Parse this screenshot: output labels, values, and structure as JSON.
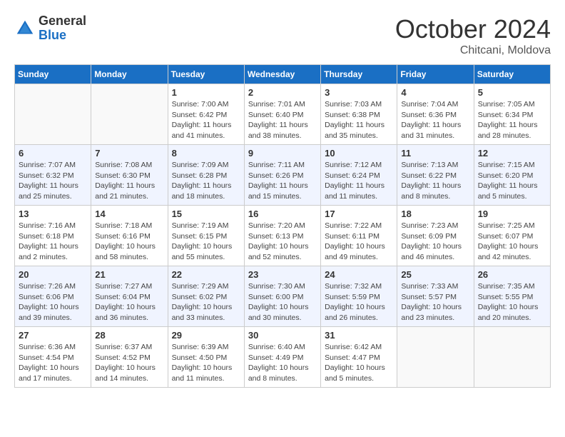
{
  "header": {
    "logo_general": "General",
    "logo_blue": "Blue",
    "month_title": "October 2024",
    "location": "Chitcani, Moldova"
  },
  "calendar": {
    "days_of_week": [
      "Sunday",
      "Monday",
      "Tuesday",
      "Wednesday",
      "Thursday",
      "Friday",
      "Saturday"
    ],
    "weeks": [
      {
        "days": [
          {
            "num": "",
            "empty": true
          },
          {
            "num": "",
            "empty": true
          },
          {
            "num": "1",
            "sunrise": "Sunrise: 7:00 AM",
            "sunset": "Sunset: 6:42 PM",
            "daylight": "Daylight: 11 hours and 41 minutes."
          },
          {
            "num": "2",
            "sunrise": "Sunrise: 7:01 AM",
            "sunset": "Sunset: 6:40 PM",
            "daylight": "Daylight: 11 hours and 38 minutes."
          },
          {
            "num": "3",
            "sunrise": "Sunrise: 7:03 AM",
            "sunset": "Sunset: 6:38 PM",
            "daylight": "Daylight: 11 hours and 35 minutes."
          },
          {
            "num": "4",
            "sunrise": "Sunrise: 7:04 AM",
            "sunset": "Sunset: 6:36 PM",
            "daylight": "Daylight: 11 hours and 31 minutes."
          },
          {
            "num": "5",
            "sunrise": "Sunrise: 7:05 AM",
            "sunset": "Sunset: 6:34 PM",
            "daylight": "Daylight: 11 hours and 28 minutes."
          }
        ]
      },
      {
        "days": [
          {
            "num": "6",
            "sunrise": "Sunrise: 7:07 AM",
            "sunset": "Sunset: 6:32 PM",
            "daylight": "Daylight: 11 hours and 25 minutes."
          },
          {
            "num": "7",
            "sunrise": "Sunrise: 7:08 AM",
            "sunset": "Sunset: 6:30 PM",
            "daylight": "Daylight: 11 hours and 21 minutes."
          },
          {
            "num": "8",
            "sunrise": "Sunrise: 7:09 AM",
            "sunset": "Sunset: 6:28 PM",
            "daylight": "Daylight: 11 hours and 18 minutes."
          },
          {
            "num": "9",
            "sunrise": "Sunrise: 7:11 AM",
            "sunset": "Sunset: 6:26 PM",
            "daylight": "Daylight: 11 hours and 15 minutes."
          },
          {
            "num": "10",
            "sunrise": "Sunrise: 7:12 AM",
            "sunset": "Sunset: 6:24 PM",
            "daylight": "Daylight: 11 hours and 11 minutes."
          },
          {
            "num": "11",
            "sunrise": "Sunrise: 7:13 AM",
            "sunset": "Sunset: 6:22 PM",
            "daylight": "Daylight: 11 hours and 8 minutes."
          },
          {
            "num": "12",
            "sunrise": "Sunrise: 7:15 AM",
            "sunset": "Sunset: 6:20 PM",
            "daylight": "Daylight: 11 hours and 5 minutes."
          }
        ]
      },
      {
        "days": [
          {
            "num": "13",
            "sunrise": "Sunrise: 7:16 AM",
            "sunset": "Sunset: 6:18 PM",
            "daylight": "Daylight: 11 hours and 2 minutes."
          },
          {
            "num": "14",
            "sunrise": "Sunrise: 7:18 AM",
            "sunset": "Sunset: 6:16 PM",
            "daylight": "Daylight: 10 hours and 58 minutes."
          },
          {
            "num": "15",
            "sunrise": "Sunrise: 7:19 AM",
            "sunset": "Sunset: 6:15 PM",
            "daylight": "Daylight: 10 hours and 55 minutes."
          },
          {
            "num": "16",
            "sunrise": "Sunrise: 7:20 AM",
            "sunset": "Sunset: 6:13 PM",
            "daylight": "Daylight: 10 hours and 52 minutes."
          },
          {
            "num": "17",
            "sunrise": "Sunrise: 7:22 AM",
            "sunset": "Sunset: 6:11 PM",
            "daylight": "Daylight: 10 hours and 49 minutes."
          },
          {
            "num": "18",
            "sunrise": "Sunrise: 7:23 AM",
            "sunset": "Sunset: 6:09 PM",
            "daylight": "Daylight: 10 hours and 46 minutes."
          },
          {
            "num": "19",
            "sunrise": "Sunrise: 7:25 AM",
            "sunset": "Sunset: 6:07 PM",
            "daylight": "Daylight: 10 hours and 42 minutes."
          }
        ]
      },
      {
        "days": [
          {
            "num": "20",
            "sunrise": "Sunrise: 7:26 AM",
            "sunset": "Sunset: 6:06 PM",
            "daylight": "Daylight: 10 hours and 39 minutes."
          },
          {
            "num": "21",
            "sunrise": "Sunrise: 7:27 AM",
            "sunset": "Sunset: 6:04 PM",
            "daylight": "Daylight: 10 hours and 36 minutes."
          },
          {
            "num": "22",
            "sunrise": "Sunrise: 7:29 AM",
            "sunset": "Sunset: 6:02 PM",
            "daylight": "Daylight: 10 hours and 33 minutes."
          },
          {
            "num": "23",
            "sunrise": "Sunrise: 7:30 AM",
            "sunset": "Sunset: 6:00 PM",
            "daylight": "Daylight: 10 hours and 30 minutes."
          },
          {
            "num": "24",
            "sunrise": "Sunrise: 7:32 AM",
            "sunset": "Sunset: 5:59 PM",
            "daylight": "Daylight: 10 hours and 26 minutes."
          },
          {
            "num": "25",
            "sunrise": "Sunrise: 7:33 AM",
            "sunset": "Sunset: 5:57 PM",
            "daylight": "Daylight: 10 hours and 23 minutes."
          },
          {
            "num": "26",
            "sunrise": "Sunrise: 7:35 AM",
            "sunset": "Sunset: 5:55 PM",
            "daylight": "Daylight: 10 hours and 20 minutes."
          }
        ]
      },
      {
        "days": [
          {
            "num": "27",
            "sunrise": "Sunrise: 6:36 AM",
            "sunset": "Sunset: 4:54 PM",
            "daylight": "Daylight: 10 hours and 17 minutes."
          },
          {
            "num": "28",
            "sunrise": "Sunrise: 6:37 AM",
            "sunset": "Sunset: 4:52 PM",
            "daylight": "Daylight: 10 hours and 14 minutes."
          },
          {
            "num": "29",
            "sunrise": "Sunrise: 6:39 AM",
            "sunset": "Sunset: 4:50 PM",
            "daylight": "Daylight: 10 hours and 11 minutes."
          },
          {
            "num": "30",
            "sunrise": "Sunrise: 6:40 AM",
            "sunset": "Sunset: 4:49 PM",
            "daylight": "Daylight: 10 hours and 8 minutes."
          },
          {
            "num": "31",
            "sunrise": "Sunrise: 6:42 AM",
            "sunset": "Sunset: 4:47 PM",
            "daylight": "Daylight: 10 hours and 5 minutes."
          },
          {
            "num": "",
            "empty": true
          },
          {
            "num": "",
            "empty": true
          }
        ]
      }
    ]
  }
}
